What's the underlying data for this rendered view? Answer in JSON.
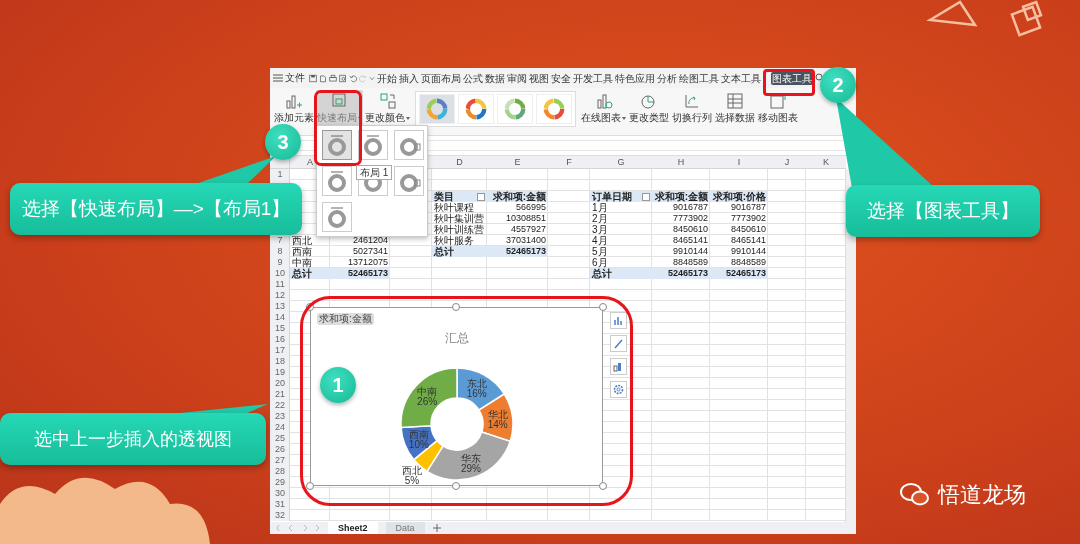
{
  "menu": {
    "file": "文件",
    "tabs": [
      {
        "label": "开始",
        "selected": false
      },
      {
        "label": "插入",
        "selected": false
      },
      {
        "label": "页面布局",
        "selected": false
      },
      {
        "label": "公式",
        "selected": false
      },
      {
        "label": "数据",
        "selected": false
      },
      {
        "label": "审阅",
        "selected": false
      },
      {
        "label": "视图",
        "selected": false
      },
      {
        "label": "安全",
        "selected": false
      },
      {
        "label": "开发工具",
        "selected": false
      },
      {
        "label": "特色应用",
        "selected": false
      },
      {
        "label": "分析",
        "selected": false
      },
      {
        "label": "绘图工具",
        "selected": false
      },
      {
        "label": "文本工具",
        "selected": false
      },
      {
        "label": "图表工具",
        "selected": true
      }
    ]
  },
  "ribbon": {
    "before": [
      {
        "label": "添加元素",
        "dropdown": false,
        "selected": false
      },
      {
        "label": "快速布局",
        "dropdown": true,
        "selected": true
      },
      {
        "label": "更改颜色",
        "dropdown": true,
        "selected": false
      }
    ],
    "styles": [
      {
        "selected": true
      },
      {
        "selected": false
      },
      {
        "selected": false
      },
      {
        "selected": false
      }
    ],
    "after": [
      {
        "label": "在线图表",
        "dropdown": true,
        "selected": false
      },
      {
        "label": "更改类型",
        "dropdown": false,
        "selected": false
      },
      {
        "label": "切换行列",
        "dropdown": false,
        "selected": false
      },
      {
        "label": "选择数据",
        "dropdown": false,
        "selected": false
      },
      {
        "label": "移动图表",
        "dropdown": false,
        "selected": false
      }
    ]
  },
  "layout_menu": {
    "tooltip": "布局 1",
    "items": [
      {
        "selected": true
      },
      {
        "selected": false
      },
      {
        "selected": false
      },
      {
        "selected": false
      },
      {
        "selected": false
      },
      {
        "selected": false
      },
      {
        "selected": false
      }
    ]
  },
  "sheet": {
    "columns": [
      "A",
      "D",
      "E",
      "F",
      "G",
      "H",
      "I",
      "J",
      "K"
    ],
    "row_numbers": [
      "1",
      "7",
      "8",
      "9",
      "10",
      "11",
      "12",
      "13",
      "14",
      "15",
      "16",
      "17",
      "18",
      "19",
      "20",
      "21",
      "22",
      "23",
      "24",
      "25",
      "26",
      "27",
      "28",
      "29",
      "30",
      "31",
      "32"
    ],
    "tables": [
      {
        "rows": [
          [
            "西北",
            "2461204"
          ],
          [
            "西南",
            "5027341"
          ],
          [
            "中南",
            "13712075"
          ]
        ],
        "total": [
          "总计",
          "52465173"
        ]
      },
      {
        "header": [
          "类目",
          "求和项:金额"
        ],
        "rows": [
          [
            "秋叶课程",
            "566995"
          ],
          [
            "秋叶集训营",
            "10308851"
          ],
          [
            "秋叶训练营",
            "4557927"
          ],
          [
            "秋叶服务",
            "37031400"
          ]
        ],
        "total": [
          "总计",
          "52465173"
        ]
      },
      {
        "header": [
          "订单日期",
          "求和项:金额",
          "求和项:价格"
        ],
        "rows": [
          [
            "1月",
            "9016787",
            "9016787"
          ],
          [
            "2月",
            "7773902",
            "7773902"
          ],
          [
            "3月",
            "8450610",
            "8450610"
          ],
          [
            "4月",
            "8465141",
            "8465141"
          ],
          [
            "5月",
            "9910144",
            "9910144"
          ],
          [
            "6月",
            "8848589",
            "8848589"
          ]
        ],
        "total": [
          "总计",
          "52465173",
          "52465173"
        ]
      }
    ]
  },
  "chart": {
    "field_button": "求和项:金额",
    "chart_data": {
      "type": "donut",
      "title": "汇总",
      "categories": [
        "东北",
        "华北",
        "华东",
        "西北",
        "西南",
        "中南"
      ],
      "series": [
        {
          "values": [
            16,
            14,
            29,
            5,
            10,
            26
          ]
        }
      ],
      "colors": [
        "#5b9bd5",
        "#ed7d31",
        "#a5a5a5",
        "#ffc000",
        "#4472c4",
        "#70ad47"
      ],
      "value_labels": [
        "16%",
        "14%",
        "29%",
        "5%",
        "10%",
        "26%"
      ]
    }
  },
  "sheet_tabs": [
    {
      "label": "Sheet2",
      "selected": true
    },
    {
      "label": "Data",
      "selected": false
    }
  ],
  "callouts": [
    {
      "number": "3",
      "text": "选择【快速布局】—>【布局1】"
    },
    {
      "number": "2",
      "text": "选择【图表工具】"
    },
    {
      "number": "1",
      "text": "选中上一步插入的透视图"
    }
  ],
  "brand": "悟道龙场"
}
